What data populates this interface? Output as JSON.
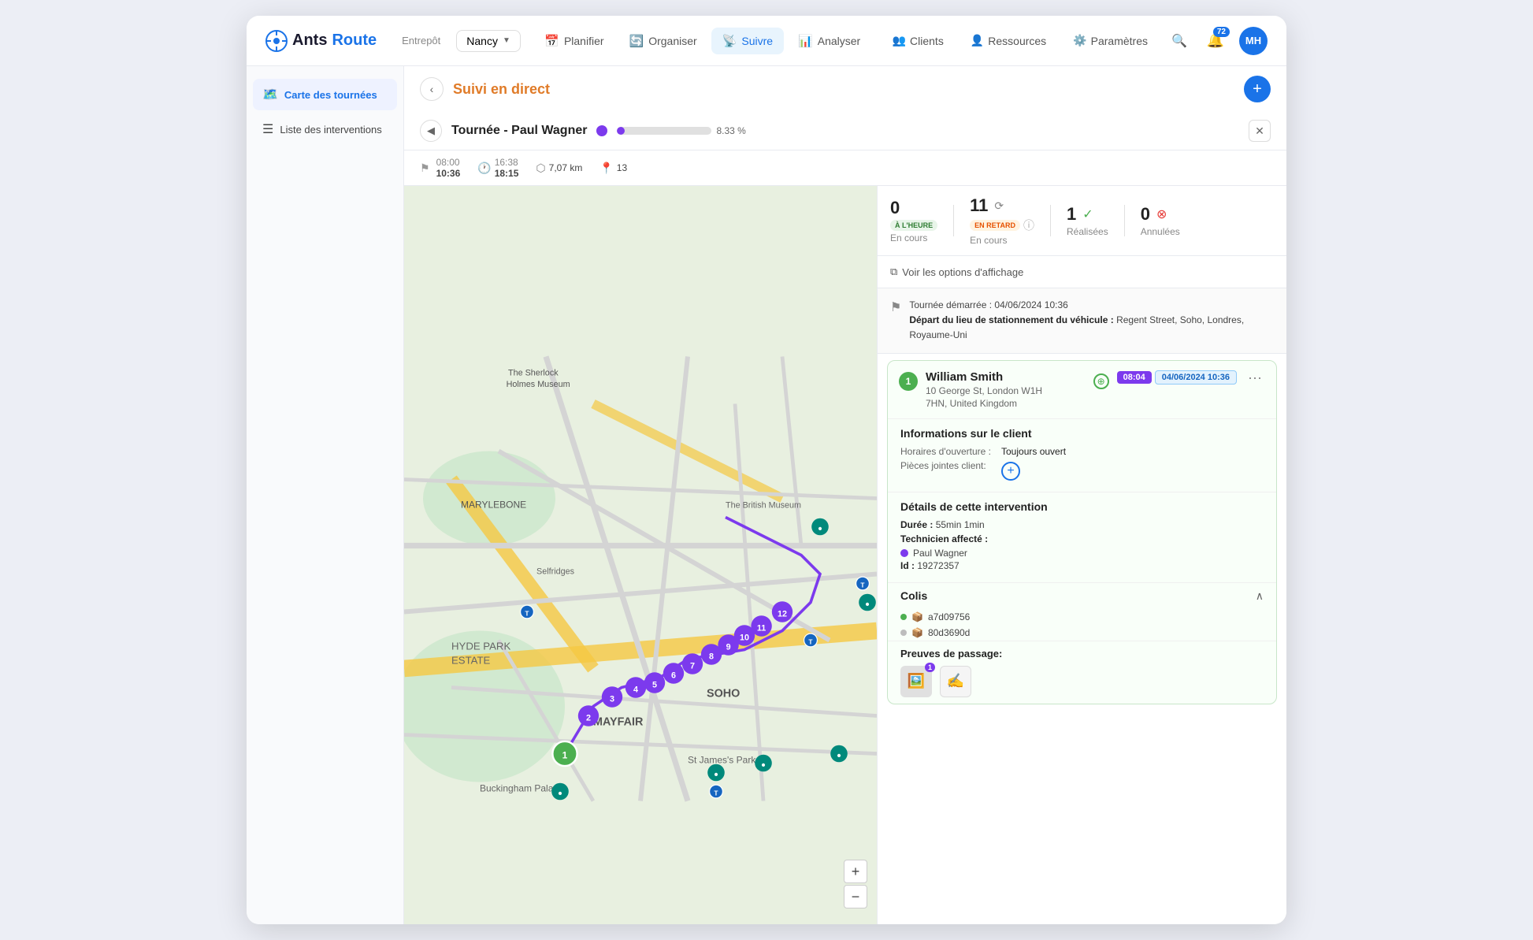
{
  "app": {
    "logo_text_ants": "Ants",
    "logo_text_route": "Route",
    "depot_label": "Entrepôt",
    "depot_value": "Nancy"
  },
  "nav": {
    "items": [
      {
        "id": "planifier",
        "label": "Planifier",
        "icon": "📅",
        "active": false
      },
      {
        "id": "organiser",
        "label": "Organiser",
        "icon": "🔄",
        "active": false
      },
      {
        "id": "suivre",
        "label": "Suivre",
        "icon": "📡",
        "active": true
      },
      {
        "id": "analyser",
        "label": "Analyser",
        "icon": "📊",
        "active": false
      }
    ],
    "clients_label": "Clients",
    "ressources_label": "Ressources",
    "parametres_label": "Paramètres"
  },
  "header": {
    "notif_count": "72",
    "avatar_initials": "MH"
  },
  "page": {
    "title": "Suivi en direct",
    "back_label": "‹",
    "add_label": "+"
  },
  "sidebar": {
    "items": [
      {
        "id": "carte",
        "label": "Carte des tournées",
        "icon": "🗺️",
        "active": true
      },
      {
        "id": "liste",
        "label": "Liste des interventions",
        "icon": "☰",
        "active": false
      }
    ]
  },
  "tour": {
    "title": "Tournée - Paul Wagner",
    "progress_percent": 8.33,
    "progress_label": "8.33 %",
    "stats": {
      "time_start": "08:00",
      "time_end": "10:36",
      "time_late_start": "16:38",
      "time_late_end": "18:15",
      "distance": "7,07 km",
      "stops": "13"
    },
    "status": {
      "on_time_count": "0",
      "on_time_label": "À L'HEURE",
      "on_time_sub": "En cours",
      "late_count": "11",
      "late_label": "EN RETARD",
      "late_sub": "En cours",
      "done_count": "1",
      "done_sub": "Réalisées",
      "cancelled_count": "0",
      "cancelled_sub": "Annulées"
    },
    "filter_label": "Voir les options d'affichage",
    "start_info": {
      "date_label": "Tournée démarrée : 04/06/2024 10:36",
      "depart_label": "Départ du lieu de stationnement du véhicule :",
      "depart_address": "Regent Street, Soho, Londres, Royaume-Uni"
    }
  },
  "intervention": {
    "number": "1",
    "name": "William Smith",
    "address_line1": "10 George St, London W1H",
    "address_line2": "7HN, United Kingdom",
    "time_badge": "08:04",
    "date_badge": "04/06/2024 10:36",
    "client_info": {
      "title": "Informations sur le client",
      "hours_label": "Horaires d'ouverture :",
      "hours_value": "Toujours ouvert",
      "attachments_label": "Pièces jointes client:"
    },
    "details": {
      "title": "Détails de cette intervention",
      "duration_label": "Durée :",
      "duration_value": "55min 1min",
      "tech_label": "Technicien affecté :",
      "tech_name": "Paul Wagner",
      "id_label": "Id :",
      "id_value": "19272357"
    },
    "colis": {
      "title": "Colis",
      "items": [
        {
          "id": "a7d09756",
          "icon": "📦",
          "status": "green"
        },
        {
          "id": "80d3690d",
          "icon": "📦",
          "status": "grey"
        }
      ]
    },
    "preuves": {
      "title": "Preuves de passage:",
      "photo_badge": "1"
    }
  }
}
